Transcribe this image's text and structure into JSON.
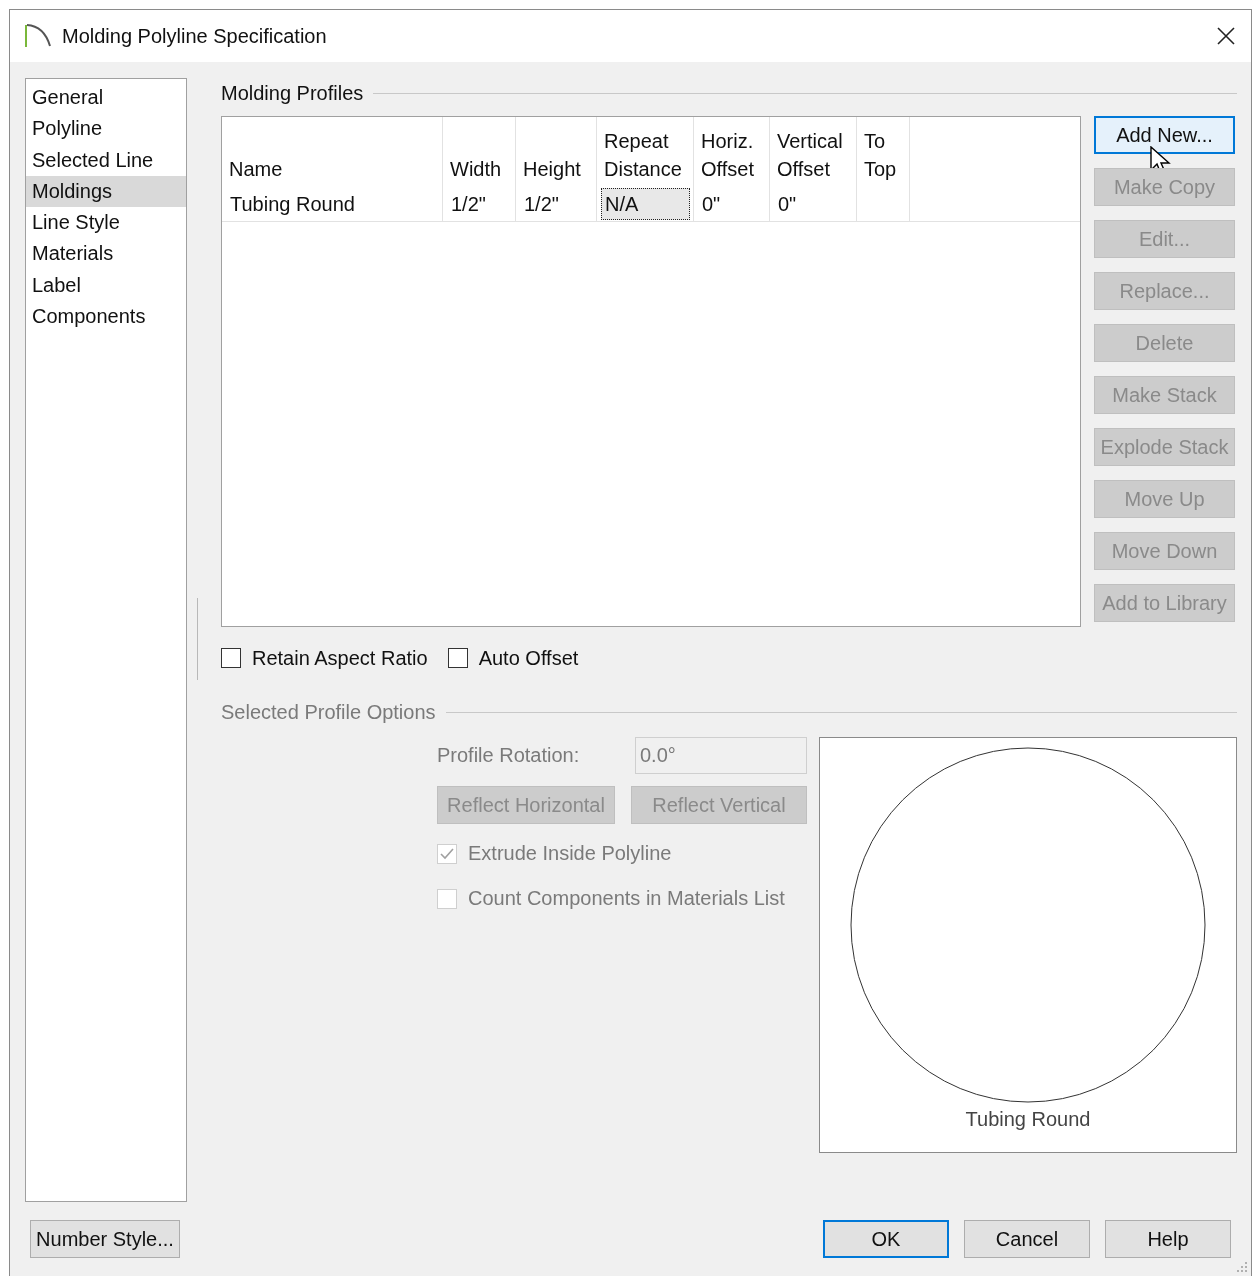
{
  "window": {
    "title": "Molding Polyline Specification"
  },
  "sidebar": {
    "items": [
      {
        "label": "General",
        "selected": false
      },
      {
        "label": "Polyline",
        "selected": false
      },
      {
        "label": "Selected Line",
        "selected": false
      },
      {
        "label": "Moldings",
        "selected": true
      },
      {
        "label": "Line Style",
        "selected": false
      },
      {
        "label": "Materials",
        "selected": false
      },
      {
        "label": "Label",
        "selected": false
      },
      {
        "label": "Components",
        "selected": false
      }
    ]
  },
  "molding_profiles": {
    "title": "Molding Profiles",
    "columns": [
      "Name",
      "Width",
      "Height",
      "Repeat Distance",
      "Horiz. Offset",
      "Vertical Offset",
      "To Top"
    ],
    "rows": [
      {
        "cells": [
          {
            "text": "Tubing Round",
            "focused": false
          },
          {
            "text": "1/2\"",
            "focused": false
          },
          {
            "text": "1/2\"",
            "focused": false
          },
          {
            "text": "N/A",
            "focused": true
          },
          {
            "text": "0\"",
            "focused": false
          },
          {
            "text": "0\"",
            "focused": false
          }
        ]
      }
    ],
    "buttons": [
      {
        "label": "Add New...",
        "disabled": false,
        "hovered": true
      },
      {
        "label": "Make Copy",
        "disabled": true,
        "hovered": false
      },
      {
        "label": "Edit...",
        "disabled": true,
        "hovered": false
      },
      {
        "label": "Replace...",
        "disabled": true,
        "hovered": false
      },
      {
        "label": "Delete",
        "disabled": true,
        "hovered": false
      },
      {
        "label": "Make Stack",
        "disabled": true,
        "hovered": false
      },
      {
        "label": "Explode Stack",
        "disabled": true,
        "hovered": false
      },
      {
        "label": "Move Up",
        "disabled": true,
        "hovered": false
      },
      {
        "label": "Move Down",
        "disabled": true,
        "hovered": false
      },
      {
        "label": "Add to Library",
        "disabled": true,
        "hovered": false
      }
    ],
    "checkboxes": [
      {
        "label": "Retain Aspect Ratio",
        "checked": false
      },
      {
        "label": "Auto Offset",
        "checked": false
      }
    ]
  },
  "selected_profile_options": {
    "title": "Selected Profile Options",
    "disabled": true,
    "profile_rotation": {
      "label": "Profile Rotation:",
      "value": "0.0°"
    },
    "buttons": [
      "Reflect Horizontal",
      "Reflect Vertical"
    ],
    "checkboxes": [
      {
        "label": "Extrude Inside Polyline",
        "checked": true
      },
      {
        "label": "Count Components in Materials List",
        "checked": false
      }
    ],
    "preview": {
      "caption": "Tubing Round"
    }
  },
  "footer": {
    "number_style_button": "Number Style...",
    "buttons": [
      {
        "label": "OK",
        "default": true
      },
      {
        "label": "Cancel",
        "default": false
      },
      {
        "label": "Help",
        "default": false
      }
    ]
  }
}
